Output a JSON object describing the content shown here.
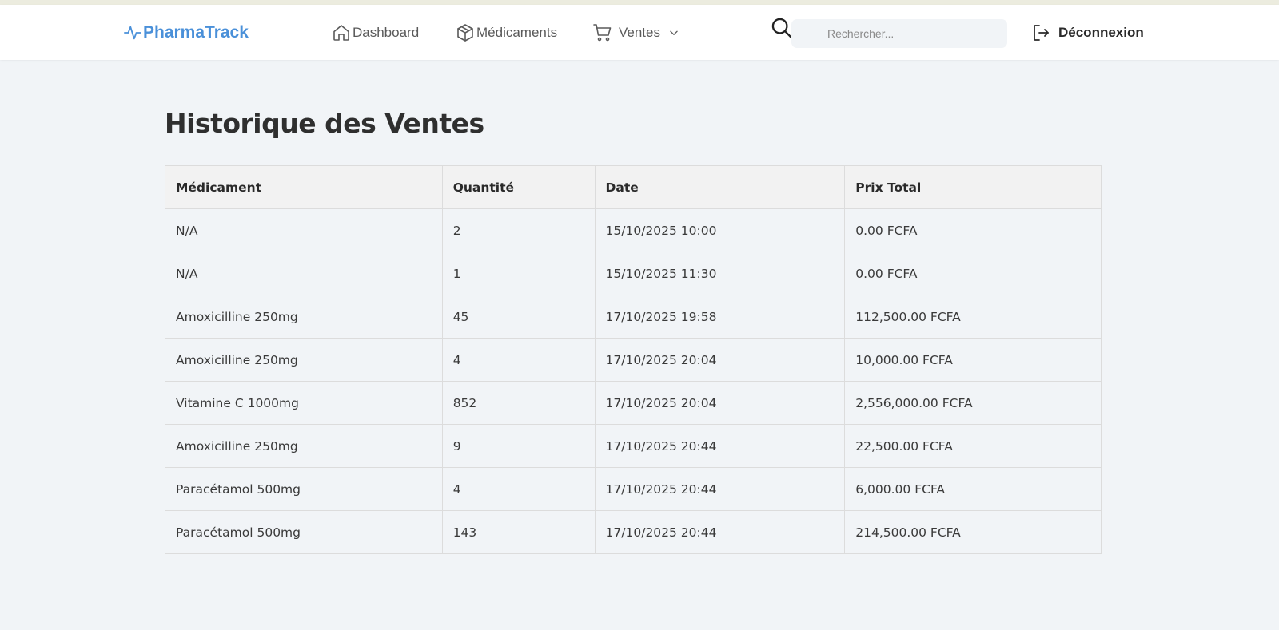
{
  "header": {
    "brand": "PharmaTrack",
    "nav": {
      "dashboard": "Dashboard",
      "medicaments": "Médicaments",
      "ventes": "Ventes"
    },
    "search_placeholder": "Rechercher...",
    "logout": "Déconnexion"
  },
  "main": {
    "title": "Historique des Ventes",
    "columns": [
      "Médicament",
      "Quantité",
      "Date",
      "Prix Total"
    ],
    "rows": [
      [
        "N/A",
        "2",
        "15/10/2025 10:00",
        "0.00 FCFA"
      ],
      [
        "N/A",
        "1",
        "15/10/2025 11:30",
        "0.00 FCFA"
      ],
      [
        "Amoxicilline 250mg",
        "45",
        "17/10/2025 19:58",
        "112,500.00 FCFA"
      ],
      [
        "Amoxicilline 250mg",
        "4",
        "17/10/2025 20:04",
        "10,000.00 FCFA"
      ],
      [
        "Vitamine C 1000mg",
        "852",
        "17/10/2025 20:04",
        "2,556,000.00 FCFA"
      ],
      [
        "Amoxicilline 250mg",
        "9",
        "17/10/2025 20:44",
        "22,500.00 FCFA"
      ],
      [
        "Paracétamol 500mg",
        "4",
        "17/10/2025 20:44",
        "6,000.00 FCFA"
      ],
      [
        "Paracétamol 500mg",
        "143",
        "17/10/2025 20:44",
        "214,500.00 FCFA"
      ]
    ]
  },
  "colors": {
    "brand": "#4a90d9",
    "background": "#f1f4f7",
    "navbar": "#ffffff",
    "table_header": "#f2f2f2"
  },
  "icons": {
    "brand": "pulse-icon",
    "dashboard": "home-icon",
    "medicaments": "box-icon",
    "ventes": "cart-icon",
    "dropdown": "chevron-down-icon",
    "search": "search-icon",
    "logout": "logout-icon"
  }
}
